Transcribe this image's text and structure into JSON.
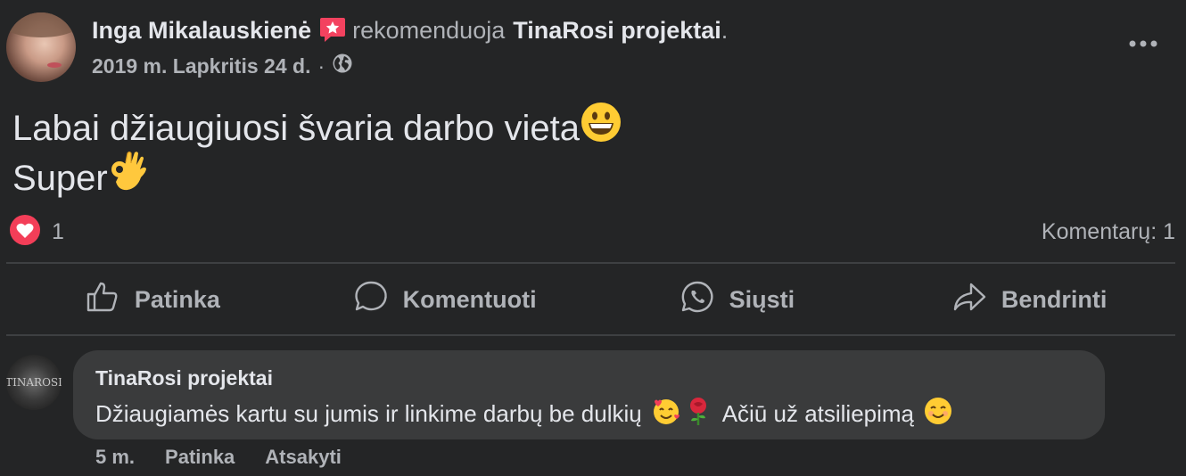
{
  "post": {
    "author": "Inga Mikalauskienė",
    "action_text": "rekomenduoja",
    "page_name": "TinaRosi projektai",
    "trailing_period": ".",
    "date": "2019 m. Lapkritis 24 d.",
    "date_separator": "·",
    "privacy_icon": "globe-icon",
    "more_icon": "ellipsis-icon",
    "text_line1": "Labai džiaugiuosi švaria darbo vieta",
    "text_line1_emoji": "grinning-face-emoji",
    "text_line2": "Super",
    "text_line2_emoji": "ok-hand-emoji"
  },
  "reactions": {
    "icon": "heart-reaction-icon",
    "count": "1",
    "comments_label": "Komentarų: 1"
  },
  "actions": {
    "like": "Patinka",
    "comment": "Komentuoti",
    "send": "Siųsti",
    "share": "Bendrinti"
  },
  "comment": {
    "author": "TinaRosi projektai",
    "avatar_text": "TINAROSI",
    "text_part1": "Džiaugiamės kartu su jumis ir linkime darbų be dulkių",
    "text_part2": "Ačiū už atsiliepimą",
    "emojis": [
      "smiling-face-with-hearts-emoji",
      "rose-emoji",
      "smiling-face-emoji"
    ],
    "time": "5 m.",
    "like": "Patinka",
    "reply": "Atsakyti"
  },
  "colors": {
    "background": "#242526",
    "bubble": "#3a3b3c",
    "primary_text": "#e4e6eb",
    "secondary_text": "#b0b3b8",
    "divider": "#3e4042",
    "heart": "#f33e58",
    "recommend_badge": "#f3425f"
  }
}
